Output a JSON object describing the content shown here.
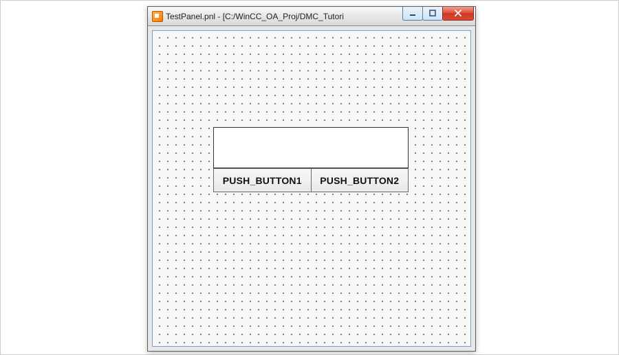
{
  "window": {
    "title": "TestPanel.pnl - [C:/WinCC_OA_Proj/DMC_Tutori"
  },
  "panel": {
    "button1_label": "PUSH_BUTTON1",
    "button2_label": "PUSH_BUTTON2",
    "textfield_value": ""
  }
}
